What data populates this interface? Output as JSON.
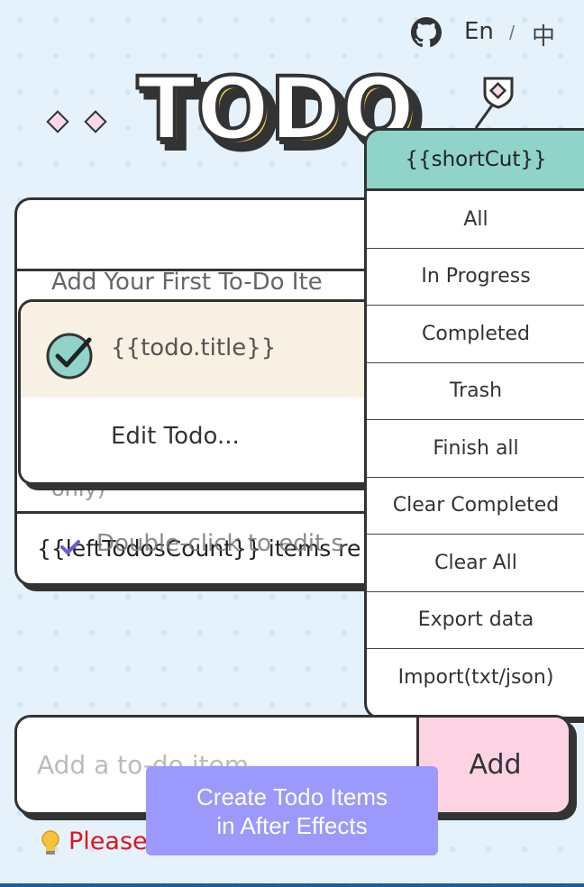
{
  "header": {
    "github_icon": "github-icon",
    "lang_en": "En",
    "lang_sep": "/",
    "lang_zh": "中",
    "logo_text": "TODO"
  },
  "card": {
    "hint_add_first": "Add Your First To-Do Ite",
    "hint_only": "only)",
    "footer_left_count": "{{leftTodosCount}} items re",
    "hint_double_click": "Double-click to edit s"
  },
  "item_panel": {
    "todo_title": "{{todo.title}}",
    "edit_label": "Edit Todo..."
  },
  "shortcut": {
    "header": "{{shortCut}}",
    "items": [
      "All",
      "In Progress",
      "Completed",
      "Trash",
      "Finish all",
      "Clear Completed",
      "Clear All",
      "Export data",
      "Import(txt/json)"
    ]
  },
  "add_row": {
    "placeholder": "Add a to-do item",
    "add_label": "Add"
  },
  "tip": {
    "text": "Please"
  },
  "ae_button": {
    "line1": "Create Todo Items",
    "line2": "in After Effects"
  },
  "colors": {
    "background": "#e6f2fb",
    "shortcut_header": "#8fd3c9",
    "item_row": "#f8f1e3",
    "add_button": "#fdd3e4",
    "ae_button": "#9b99fb",
    "tip_text": "#e0141e",
    "logo_fill": "#f8cf4b"
  }
}
